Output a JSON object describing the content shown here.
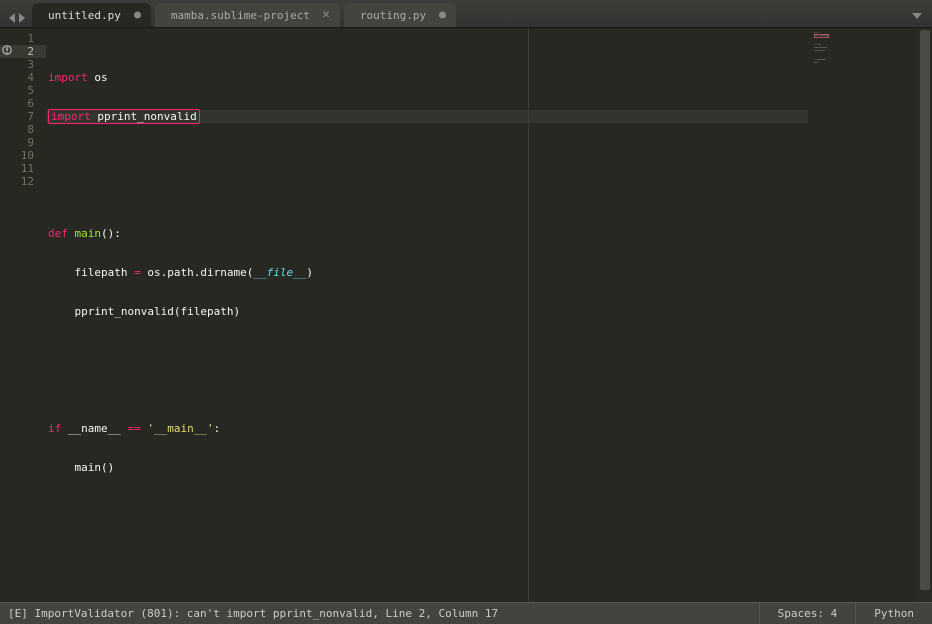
{
  "tabs": [
    {
      "label": "untitled.py",
      "dirty": true,
      "active": true
    },
    {
      "label": "mamba.sublime-project",
      "dirty": false,
      "active": false
    },
    {
      "label": "routing.py",
      "dirty": true,
      "active": false
    }
  ],
  "gutter": {
    "lines": [
      "1",
      "2",
      "3",
      "4",
      "5",
      "6",
      "7",
      "8",
      "9",
      "10",
      "11",
      "12"
    ],
    "highlighted": 2,
    "error_line": 2
  },
  "code": {
    "l1": {
      "kw": "import",
      "mod": "os"
    },
    "l2": {
      "kw": "import",
      "mod": "pprint_nonvalid"
    },
    "l5": {
      "kw": "def",
      "fn": "main",
      "paren": "():"
    },
    "l6a": "filepath ",
    "l6op": "=",
    "l6b": " os.path.dirname(",
    "l6bi": "__file__",
    "l6c": ")",
    "l7": "pprint_nonvalid(filepath)",
    "l10a": "if",
    "l10b": " __name__ ",
    "l10op": "==",
    "l10s": " '__main__'",
    "l10c": ":",
    "l11": "main()"
  },
  "status": {
    "message": "[E] ImportValidator (801): can't import pprint_nonvalid, Line 2, Column 17",
    "spaces": "Spaces: 4",
    "lang": "Python"
  }
}
